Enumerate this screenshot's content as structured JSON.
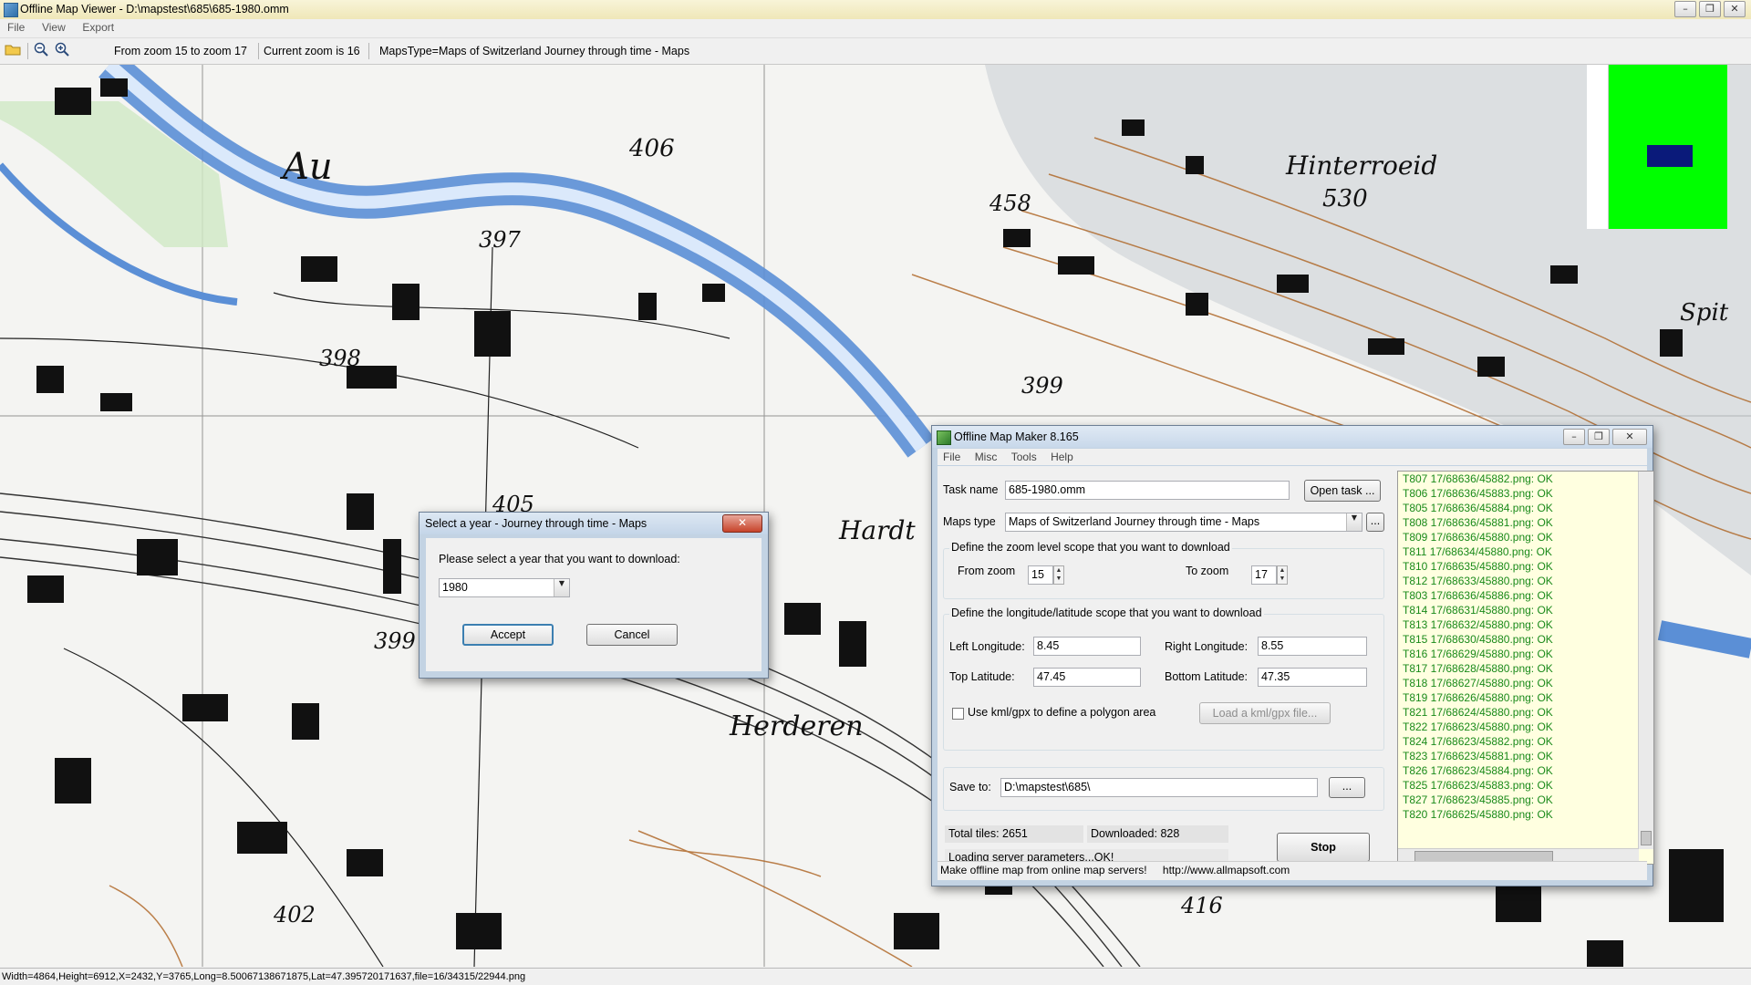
{
  "window": {
    "title": "Offline Map Viewer - D:\\mapstest\\685\\685-1980.omm",
    "controls": [
      "–",
      "❐",
      "✕"
    ]
  },
  "menubar": [
    "File",
    "View",
    "Export"
  ],
  "toolbar": {
    "zoom_range": "From zoom 15 to zoom 17",
    "current_zoom": "Current zoom is 16",
    "maps_type": "MapsType=Maps of Switzerland Journey through time - Maps"
  },
  "map_labels": [
    "Au",
    "406",
    "397",
    "458",
    "Hinterroeid",
    "530",
    "398",
    "399",
    "405",
    "Hardt",
    "399",
    "Herderen",
    "402",
    "416",
    "Spit"
  ],
  "statusbar": "Width=4864,Height=6912,X=2432,Y=3765,Long=8.500671386718​75,Lat=47.395720171637,file=16/34315/22944.png",
  "year_dialog": {
    "title": "Select a year - Journey through time - Maps",
    "prompt": "Please select a year that you want to download:",
    "year_value": "1980",
    "accept": "Accept",
    "cancel": "Cancel"
  },
  "omm": {
    "title": "Offline Map Maker 8.165",
    "menu": [
      "File",
      "Misc",
      "Tools",
      "Help"
    ],
    "task_name_label": "Task name",
    "task_name_value": "685-1980.omm",
    "open_task": "Open task ...",
    "maps_type_label": "Maps type",
    "maps_type_value": "Maps of Switzerland Journey through time - Maps",
    "ellipsis": "...",
    "zoom_group": "Define the zoom level scope that you want to download",
    "from_zoom_label": "From zoom",
    "from_zoom_value": "15",
    "to_zoom_label": "To zoom",
    "to_zoom_value": "17",
    "lonlat_group": "Define the longitude/latitude scope that you want to download",
    "left_lon_label": "Left Longitude:",
    "left_lon_value": "8.45",
    "right_lon_label": "Right Longitude:",
    "right_lon_value": "8.55",
    "top_lat_label": "Top Latitude:",
    "top_lat_value": "47.45",
    "bottom_lat_label": "Bottom Latitude:",
    "bottom_lat_value": "47.35",
    "kml_label": "Use kml/gpx to define a polygon area",
    "kml_button": "Load a kml/gpx file...",
    "save_to_label": "Save to:",
    "save_to_value": "D:\\mapstest\\685\\",
    "total_tiles": "Total tiles: 2651",
    "downloaded": "Downloaded: 828",
    "loading": "Loading server parameters...OK!",
    "stop": "Stop",
    "footer_left": "Make offline map from online map servers!",
    "footer_right": "http://www.allmapsoft.com",
    "log": [
      "T807 17/68636/45882.png: OK",
      "T806 17/68636/45883.png: OK",
      "T805 17/68636/45884.png: OK",
      "T808 17/68636/45881.png: OK",
      "T809 17/68636/45880.png: OK",
      "T811 17/68634/45880.png: OK",
      "T810 17/68635/45880.png: OK",
      "T812 17/68633/45880.png: OK",
      "T803 17/68636/45886.png: OK",
      "T814 17/68631/45880.png: OK",
      "T813 17/68632/45880.png: OK",
      "T815 17/68630/45880.png: OK",
      "T816 17/68629/45880.png: OK",
      "T817 17/68628/45880.png: OK",
      "T818 17/68627/45880.png: OK",
      "T819 17/68626/45880.png: OK",
      "T821 17/68624/45880.png: OK",
      "T822 17/68623/45880.png: OK",
      "T824 17/68623/45882.png: OK",
      "T823 17/68623/45881.png: OK",
      "T826 17/68623/45884.png: OK",
      "T825 17/68623/45883.png: OK",
      "T827 17/68623/45885.png: OK",
      "T820 17/68625/45880.png: OK"
    ]
  },
  "colors": {
    "river": "#5b8fd6",
    "contour": "#b06a2c",
    "minimap_bg": "#00ff00",
    "minimap_view": "#0a1a7a",
    "log_text": "#1a8a1a",
    "log_bg": "#ffffe0"
  }
}
